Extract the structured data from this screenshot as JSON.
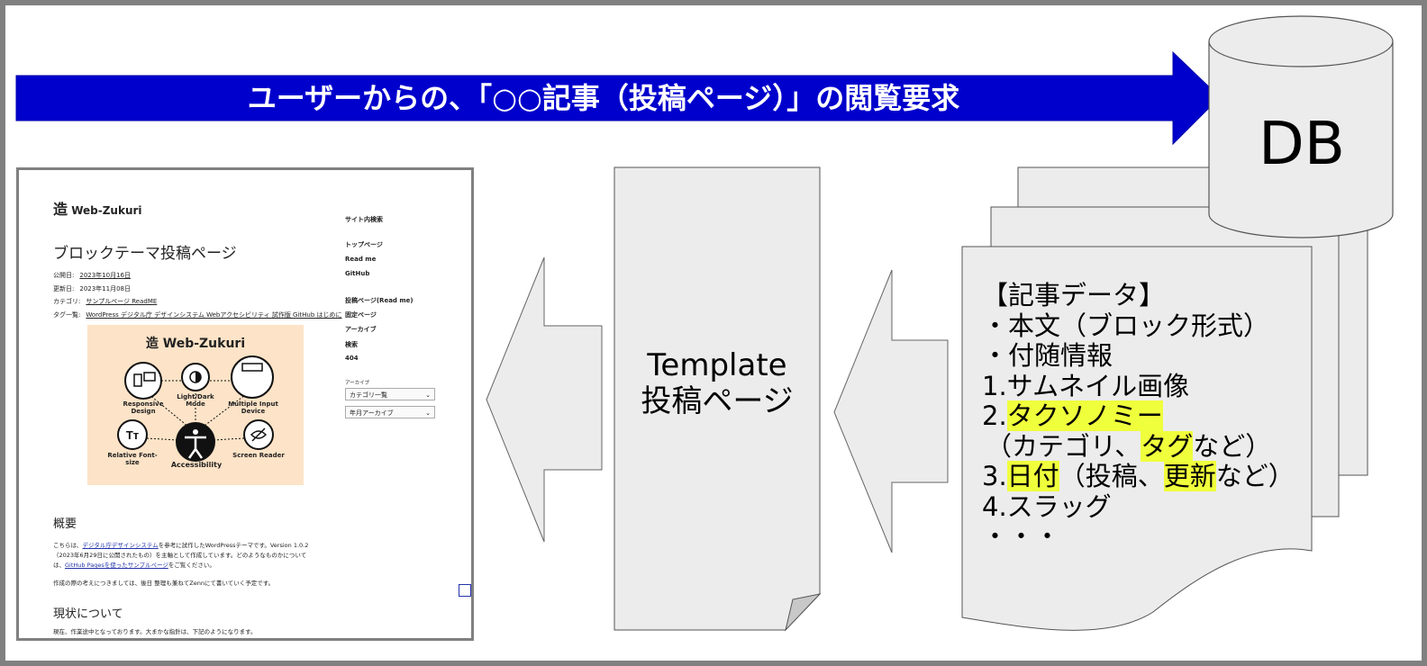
{
  "request_arrow": {
    "label": "ユーザーからの、「○○記事（投稿ページ）」の閲覧要求",
    "color": "#0000cc"
  },
  "db": {
    "label": "DB"
  },
  "template": {
    "line1": "Template",
    "line2": "投稿ページ"
  },
  "article_data": {
    "title": "【記事データ】",
    "lines": [
      {
        "text": "・本文（ブロック形式）"
      },
      {
        "text": "・付随情報"
      },
      {
        "text": "1.サムネイル画像"
      },
      {
        "prefix": "2.",
        "highlight": "タクソノミー",
        "rest": ""
      },
      {
        "prefix": "（カテゴリ、",
        "highlight": "タグ",
        "rest": "など）"
      },
      {
        "prefix": "3.",
        "highlight": "日付",
        "mid": "（投稿、",
        "highlight2": "更新",
        "rest": "など）"
      },
      {
        "text": "4.スラッグ"
      },
      {
        "text": "・・・"
      }
    ],
    "highlight_color": "#f0ff3c"
  },
  "screenshot": {
    "logo": "Web-Zukuri",
    "logo_kanji": "造",
    "page_title": "ブロックテーマ投稿ページ",
    "published_label": "公開日:",
    "published": "2023年10月16日",
    "updated_label": "更新日:",
    "updated": "2023年11月08日",
    "category_label": "カテゴリ:",
    "categories": "サンプルページ ReadME",
    "tags_label": "タグ一覧:",
    "tags": "WordPress デジタル庁 デザインシステム Webアクセシビリティ 試作版 GitHub はじめに",
    "sidebar": {
      "search": "サイト内検索",
      "links": [
        "トップページ",
        "Read me",
        "GitHub"
      ],
      "links2": [
        "投稿ページ(Read me)",
        "固定ページ",
        "アーカイブ",
        "検索",
        "404"
      ],
      "archive_label": "アーカイブ",
      "select1": "カテゴリ一覧",
      "select2": "年月アーカイブ"
    },
    "hero": {
      "title": "Web-Zukuri",
      "features": [
        "Responsive Design",
        "Light/Dark Mode",
        "Multiple Input Device",
        "Relative Font-size",
        "Accessibility",
        "Screen Reader"
      ]
    },
    "section1": "概要",
    "para1a": "こちらは、",
    "para1_link": "デジタル庁デザインシステム",
    "para1b": "を参考に試作したWordPressテーマです。Version 1.0.2",
    "para1c": "（2023年6月29日に公開されたもの）を主軸として作成しています。どのようなものかについて",
    "para1d": "は、",
    "para1_link2": "GitHub Pagesを使ったサンプルページ",
    "para1e": "をご覧ください。",
    "para2": "作成の際の考えにつきましては、後日 整理も兼ねてZennにて書いていく予定です。",
    "section2": "現状について",
    "para3": "現在、作業途中となっております。大まかな指針は、下記のようになります。"
  }
}
